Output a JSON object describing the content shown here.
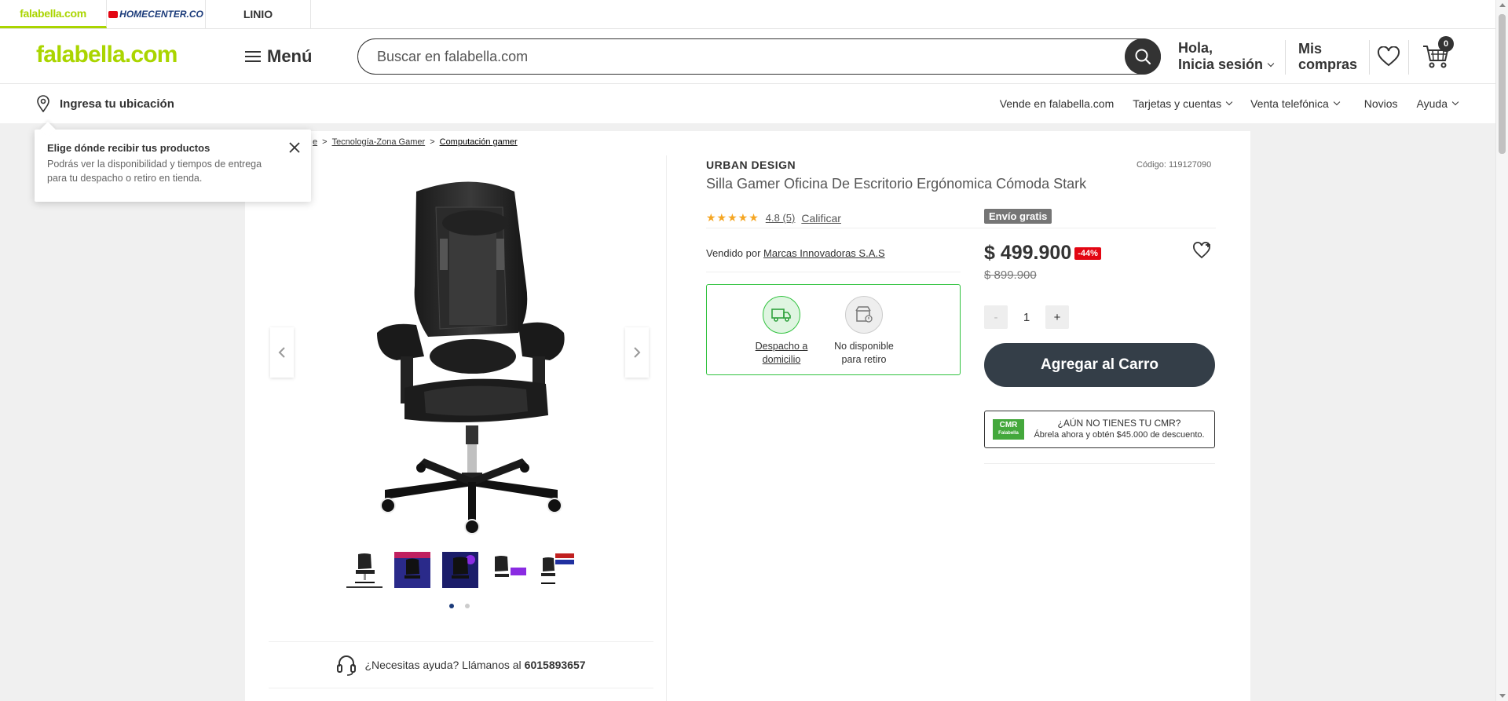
{
  "brand_tabs": [
    {
      "label": "falabella.com"
    },
    {
      "label": "HOMECENTER.CO"
    },
    {
      "label": "LINIO"
    }
  ],
  "header": {
    "logo": "falabella.com",
    "menu_label": "Menú",
    "search_placeholder": "Buscar en falabella.com",
    "greeting": "Hola,",
    "login_label": "Inicia sesión",
    "orders_line1": "Mis",
    "orders_line2": "compras",
    "cart_count": "0"
  },
  "subheader": {
    "location_label": "Ingresa tu ubicación",
    "nav": [
      "Vende en falabella.com",
      "Tarjetas y cuentas",
      "Venta telefónica",
      "Novios",
      "Ayuda"
    ]
  },
  "tooltip": {
    "title": "Elige dónde recibir tus productos",
    "body": "Podrás ver la disponibilidad y tiempos de entrega para tu despacho o retiro en tienda."
  },
  "breadcrumb": {
    "partial": "e",
    "sep": ">",
    "items": [
      "Tecnología-Zona Gamer",
      "Computación gamer"
    ]
  },
  "product": {
    "brand": "URBAN DESIGN",
    "code": "Código: 119127090",
    "title": "Silla Gamer Oficina De Escritorio Ergónomica Cómoda Stark",
    "stars": "★★★★★",
    "rating": "4.8 (5)",
    "rate_label": "Calificar",
    "seller_prefix": "Vendido por",
    "seller": "Marcas Innovadoras S.A.S",
    "delivery": {
      "home_line1": "Despacho a",
      "home_line2": "domicilio",
      "pickup_line1": "No disponible",
      "pickup_line2": "para retiro"
    },
    "free_shipping": "Envío gratis",
    "price": "$ 499.900",
    "discount": "-44%",
    "old_price": "$ 899.900",
    "qty_minus": "-",
    "qty": "1",
    "qty_plus": "+",
    "add_to_cart": "Agregar al Carro",
    "cmr": {
      "logo": "CMR",
      "logo_sub": "Falabella",
      "line1": "¿AÚN NO TIENES TU CMR?",
      "line2": "Ábrela ahora y obtén $45.000 de descuento."
    }
  },
  "help": {
    "text": "¿Necesitas ayuda? Llámanos al",
    "phone": "6015893657"
  },
  "colors": {
    "brand_green": "#aad500",
    "dark": "#343e48",
    "discount_red": "#e30613",
    "delivery_green": "#30c23e"
  }
}
